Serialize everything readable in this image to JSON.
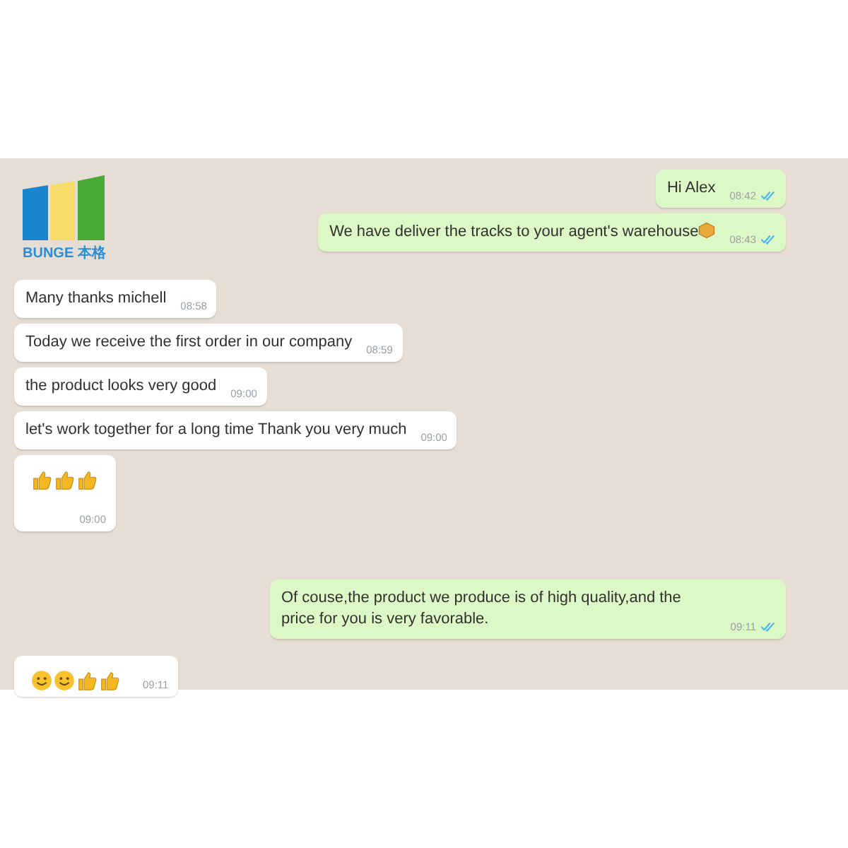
{
  "logo": {
    "text": "BUNGE 本格"
  },
  "messages": [
    {
      "kind": "outgoing",
      "text": "Hi Alex",
      "time": "08:42",
      "read": true
    },
    {
      "kind": "outgoing",
      "text": "We have deliver the tracks to your agent's warehouse",
      "trailing_emoji": [
        {
          "kind": "package"
        }
      ],
      "time": "08:43",
      "read": true
    },
    {
      "kind": "incoming",
      "text": "Many thanks michell",
      "time": "08:58"
    },
    {
      "kind": "incoming",
      "text": "Today we receive the first order in our company",
      "time": "08:59"
    },
    {
      "kind": "incoming",
      "text": "the product looks very good",
      "time": "09:00"
    },
    {
      "kind": "incoming",
      "text": "let's work together for a long time Thank you very much",
      "time": "09:00"
    },
    {
      "kind": "incoming",
      "emoji": [
        {
          "kind": "thumbs-up"
        },
        {
          "kind": "thumbs-up"
        },
        {
          "kind": "thumbs-up"
        }
      ],
      "time": "09:00"
    },
    {
      "kind": "outgoing",
      "text": "Of couse,the product we produce is of high quality,and the price for you is very favorable.",
      "time": "09:11",
      "read": true
    },
    {
      "kind": "incoming",
      "emoji": [
        {
          "kind": "smile"
        },
        {
          "kind": "smile"
        },
        {
          "kind": "thumbs-up"
        },
        {
          "kind": "thumbs-up"
        }
      ],
      "time": "09:11"
    }
  ]
}
